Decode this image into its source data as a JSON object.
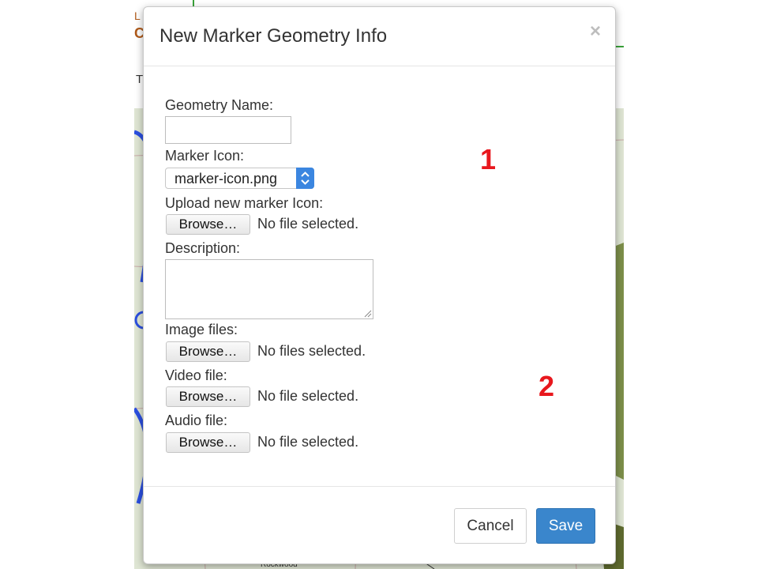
{
  "background": {
    "logo_line1": "L",
    "logo_line2": "C",
    "tab_letter": "T",
    "map_label": "Rockwood",
    "map_water_color": "#2b4fe0",
    "map_land_color": "#d9e3cf",
    "brand_green": "#3aa23a"
  },
  "modal": {
    "title": "New Marker Geometry Info",
    "close_symbol": "×",
    "fields": {
      "geometry_name_label": "Geometry Name:",
      "geometry_name_value": "",
      "marker_icon_label": "Marker Icon:",
      "marker_icon_selected": "marker-icon.png",
      "upload_icon_label": "Upload new marker Icon:",
      "upload_icon_button": "Browse…",
      "upload_icon_status": "No file selected.",
      "description_label": "Description:",
      "description_value": "",
      "image_files_label": "Image files:",
      "image_files_button": "Browse…",
      "image_files_status": "No files selected.",
      "video_file_label": "Video file:",
      "video_file_button": "Browse…",
      "video_file_status": "No file selected.",
      "audio_file_label": "Audio file:",
      "audio_file_button": "Browse…",
      "audio_file_status": "No file selected."
    },
    "annotations": [
      "1",
      "2"
    ],
    "footer": {
      "cancel_label": "Cancel",
      "save_label": "Save"
    }
  },
  "colors": {
    "primary": "#3a86cc",
    "annotation_red": "#e8171d",
    "select_accent": "#3b86e0"
  }
}
